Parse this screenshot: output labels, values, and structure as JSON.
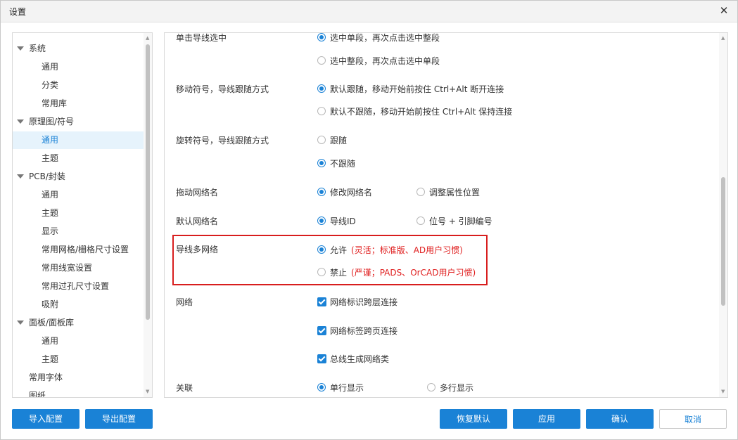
{
  "window": {
    "title": "设置"
  },
  "tree": {
    "items": [
      {
        "label": "系统",
        "expandable": true
      },
      {
        "label": "通用"
      },
      {
        "label": "分类"
      },
      {
        "label": "常用库"
      },
      {
        "label": "原理图/符号",
        "expandable": true
      },
      {
        "label": "通用",
        "selected": true
      },
      {
        "label": "主题"
      },
      {
        "label": "PCB/封装",
        "expandable": true
      },
      {
        "label": "通用"
      },
      {
        "label": "主题"
      },
      {
        "label": "显示"
      },
      {
        "label": "常用网格/栅格尺寸设置"
      },
      {
        "label": "常用线宽设置"
      },
      {
        "label": "常用过孔尺寸设置"
      },
      {
        "label": "吸附"
      },
      {
        "label": "面板/面板库",
        "expandable": true
      },
      {
        "label": "通用"
      },
      {
        "label": "主题"
      },
      {
        "label": "常用字体"
      },
      {
        "label": "图纸"
      }
    ]
  },
  "settings": {
    "click_wire_select": {
      "label": "单击导线选中",
      "options": [
        "选中单段，再次点击选中整段",
        "选中整段，再次点击选中单段"
      ],
      "selected": 0
    },
    "move_symbol_follow": {
      "label": "移动符号，导线跟随方式",
      "options": [
        "默认跟随，移动开始前按住 Ctrl+Alt 断开连接",
        "默认不跟随，移动开始前按住 Ctrl+Alt 保持连接"
      ],
      "selected": 0
    },
    "rotate_symbol_follow": {
      "label": "旋转符号，导线跟随方式",
      "options": [
        "跟随",
        "不跟随"
      ],
      "selected": 1
    },
    "drag_net_name": {
      "label": "拖动网络名",
      "options": [
        "修改网络名",
        "调整属性位置"
      ],
      "selected": 0
    },
    "default_net_name": {
      "label": "默认网络名",
      "options": [
        "导线ID",
        "位号 + 引脚编号"
      ],
      "selected": 0
    },
    "wire_multi_net": {
      "label": "导线多网络",
      "options": [
        {
          "text": "允许",
          "note": "(灵活；标准版、AD用户习惯)"
        },
        {
          "text": "禁止",
          "note": "(严谨；PADS、OrCAD用户习惯)"
        }
      ],
      "selected": 0
    },
    "net": {
      "label": "网络",
      "checks": [
        {
          "text": "网络标识跨层连接",
          "checked": true
        },
        {
          "text": "网络标签跨页连接",
          "checked": true
        },
        {
          "text": "总线生成网络类",
          "checked": true
        }
      ]
    },
    "association": {
      "label": "关联",
      "options": [
        "单行显示",
        "多行显示"
      ],
      "selected": 0
    }
  },
  "buttons": {
    "import": "导入配置",
    "export": "导出配置",
    "restore": "恢复默认",
    "apply": "应用",
    "confirm": "确认",
    "cancel": "取消"
  },
  "colors": {
    "accent": "#1a82d6",
    "highlight_border": "#d81e1e",
    "note_text": "#e02020"
  }
}
